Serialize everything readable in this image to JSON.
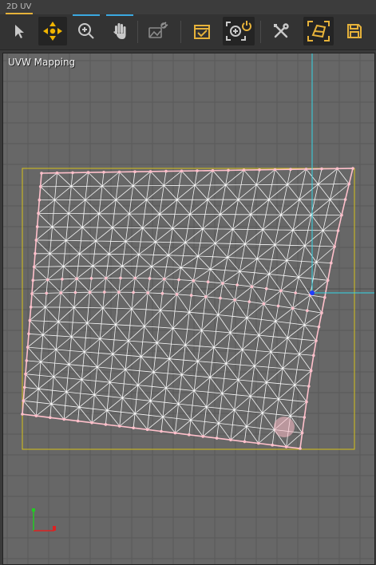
{
  "panel": {
    "title": "2D UV"
  },
  "toolbar": {
    "tools": [
      {
        "id": "select",
        "icon": "arrow-cursor-icon"
      },
      {
        "id": "move",
        "icon": "move-arrows-icon",
        "active": true
      },
      {
        "id": "zoom",
        "icon": "zoom-icon",
        "underline": true
      },
      {
        "id": "pan",
        "icon": "hand-icon",
        "underline": true
      },
      {
        "id": "map",
        "icon": "image-map-icon"
      },
      {
        "id": "checker",
        "icon": "checkbox-icon"
      },
      {
        "id": "zoom-extents",
        "icon": "zoom-power-icon",
        "active": true
      },
      {
        "id": "tools",
        "icon": "wrench-screwdriver-icon"
      },
      {
        "id": "frame",
        "icon": "frame-select-icon"
      },
      {
        "id": "save",
        "icon": "save-icon"
      }
    ],
    "colors": {
      "accent": "#e6b23a",
      "underline": "#3aa8e0",
      "icon": "#c9c9c9"
    }
  },
  "viewport": {
    "label": "UVW Mapping",
    "colors": {
      "background": "#676767",
      "grid": "#5a5a5a",
      "mesh": "#ffffff",
      "vertex": "#ffc0cb",
      "bounds": "#d6c21a",
      "crosshair": "#33d6e6",
      "pivot": "#1f3cff"
    }
  }
}
